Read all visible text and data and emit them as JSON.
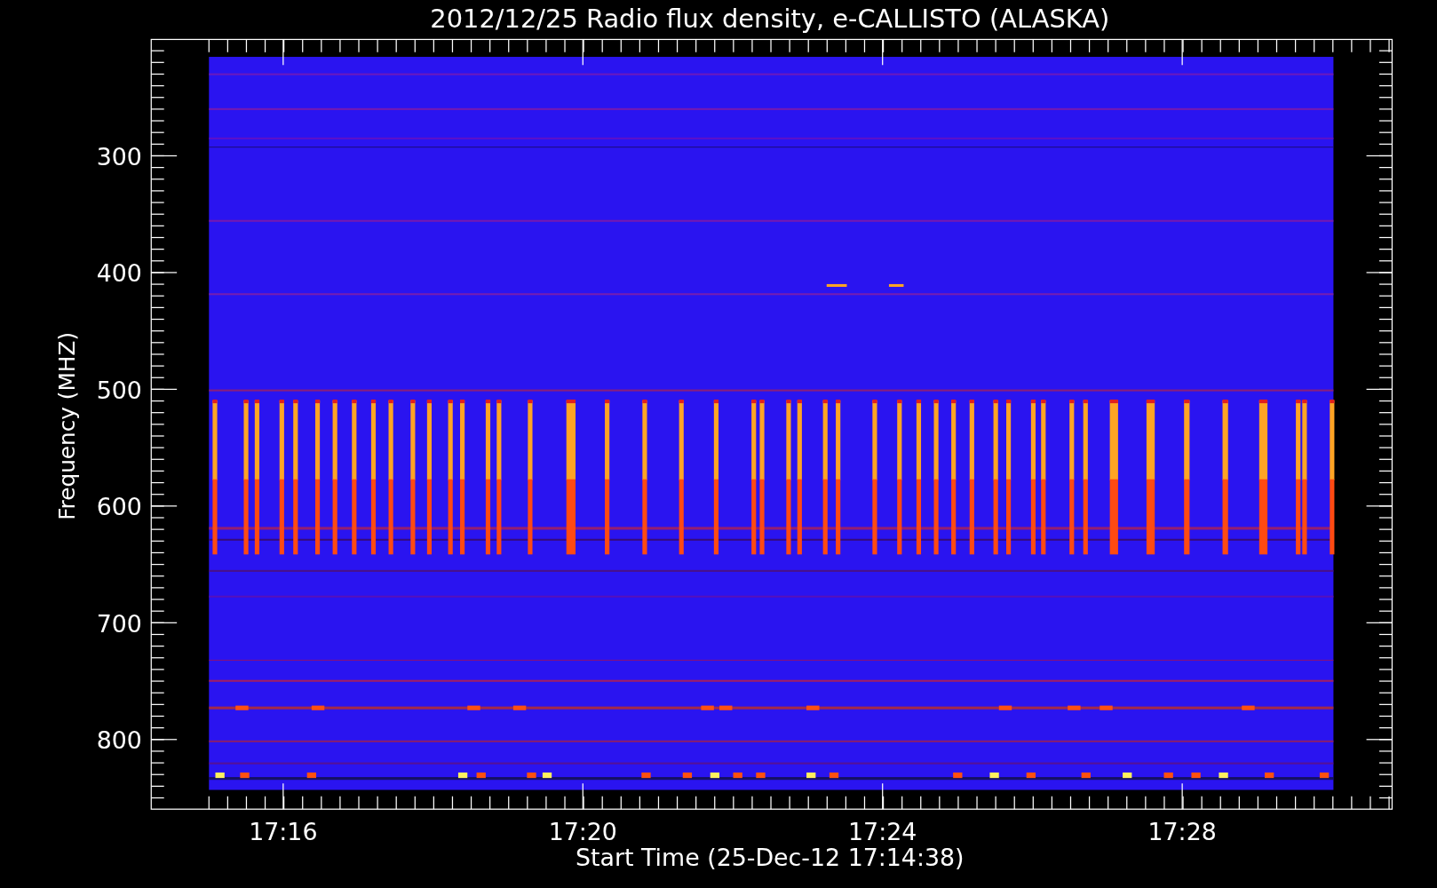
{
  "chart": {
    "title": "2012/12/25  Radio flux density, e-CALLISTO (ALASKA)",
    "xlabel": "Start Time (25-Dec-12 17:14:38)",
    "ylabel": "Frequency (MHZ)",
    "xticks": [
      "17:16",
      "17:20",
      "17:24",
      "17:28"
    ],
    "yticks": [
      "300",
      "400",
      "500",
      "600",
      "700",
      "800"
    ]
  }
}
